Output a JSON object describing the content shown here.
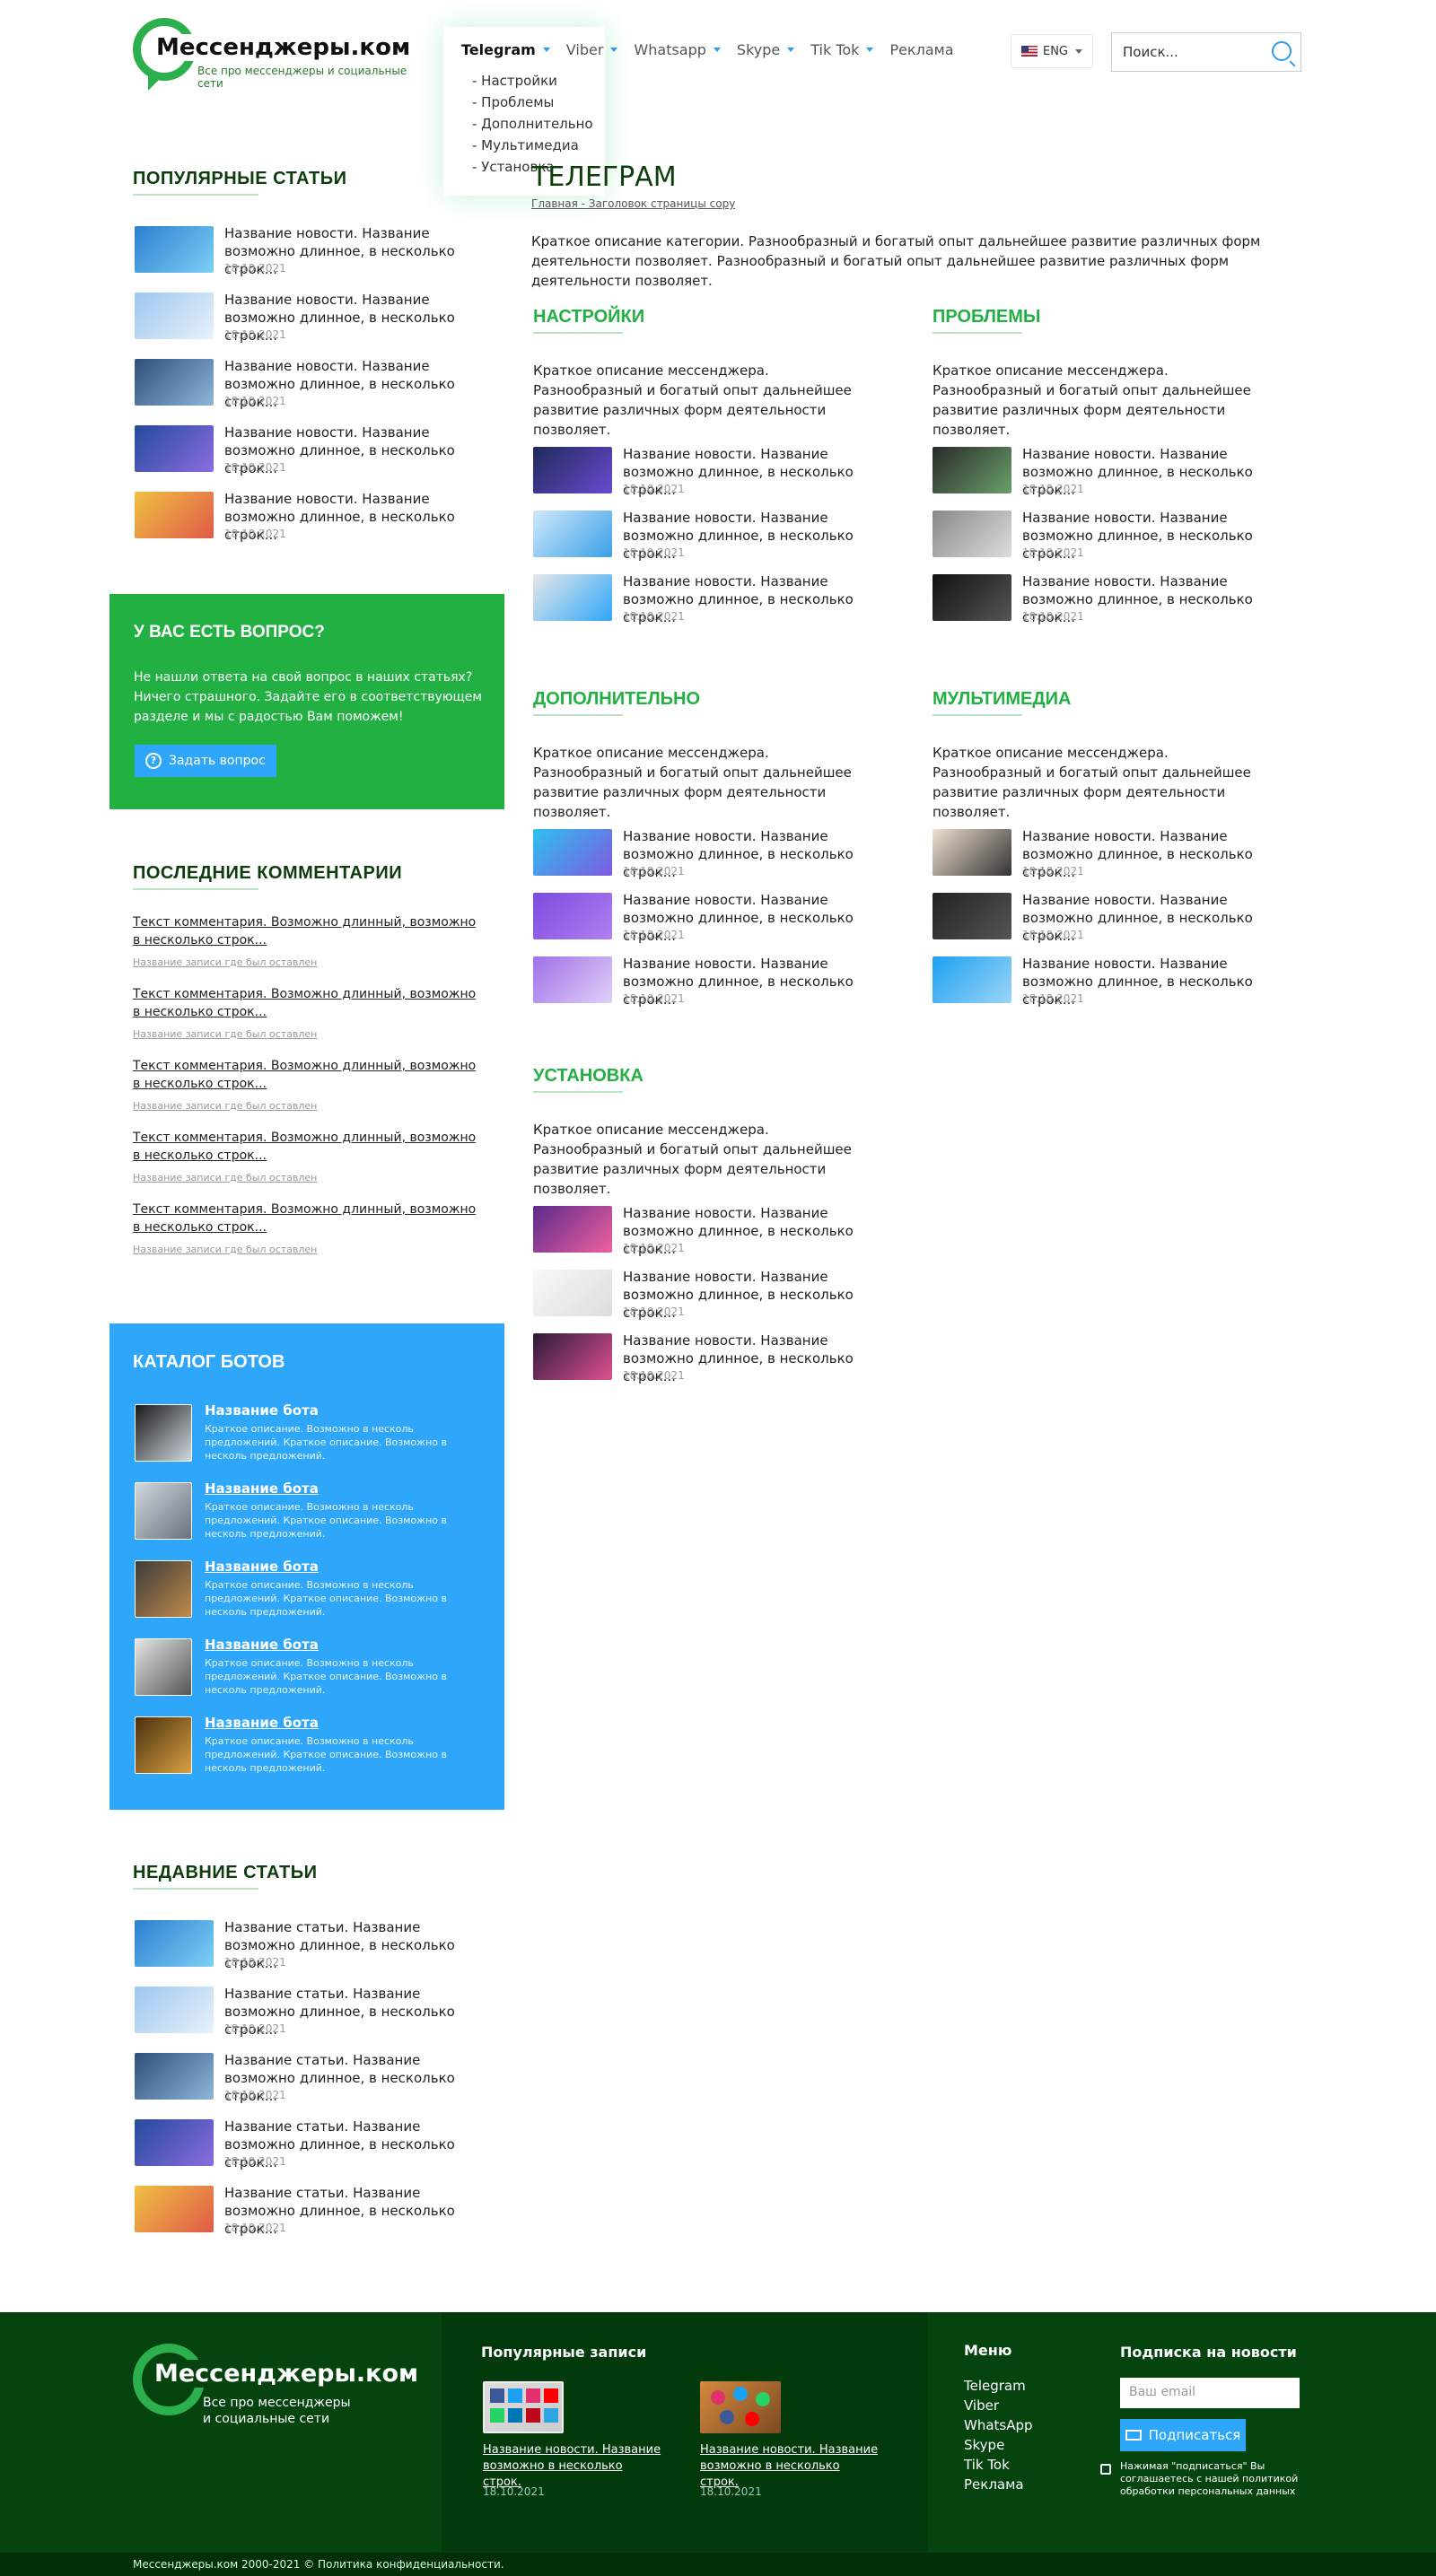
{
  "header": {
    "logo_title": "Мессенджеры.ком",
    "logo_sub": "Все про мессенджеры и социальные сети",
    "nav": [
      "Telegram",
      "Viber",
      "Whatsapp",
      "Skype",
      "Tik Tok",
      "Реклама"
    ],
    "dropdown": [
      "- Настройки",
      "- Проблемы",
      "- Дополнительно",
      "- Мультимедиа",
      "- Установка"
    ],
    "lang": "ENG",
    "search_placeholder": "Поиск..."
  },
  "sidebar": {
    "popular_title": "ПОПУЛЯРНЫЕ СТАТЬИ",
    "popular": [
      {
        "title": "Название новости. Название возможно длинное, в несколько строк...",
        "date": "18.10.2021"
      },
      {
        "title": "Название новости. Название возможно длинное, в несколько строк...",
        "date": "18.10.2021"
      },
      {
        "title": "Название новости. Название возможно длинное, в несколько строк...",
        "date": "18.10.2021"
      },
      {
        "title": "Название новости. Название возможно длинное, в несколько строк...",
        "date": "18.10.2021"
      },
      {
        "title": "Название новости. Название возможно длинное, в несколько строк...",
        "date": "18.10.2021"
      }
    ],
    "question_title": "У ВАС ЕСТЬ ВОПРОС?",
    "question_text": "Не нашли ответа на свой вопрос в наших статьях? Ничего страшного. Задайте его в соответствующем разделе и мы с радостью Вам поможем!",
    "ask_button": "Задать вопрос",
    "comments_title": "ПОСЛЕДНИЕ КОММЕНТАРИИ",
    "comments": [
      {
        "text": "Текст комментария. Возможно длинный, возможно в несколько строк...",
        "src": "Название записи где был оставлен"
      },
      {
        "text": "Текст комментария. Возможно длинный, возможно в несколько строк...",
        "src": "Название записи где был оставлен"
      },
      {
        "text": "Текст комментария. Возможно длинный, возможно в несколько строк...",
        "src": "Название записи где был оставлен"
      },
      {
        "text": "Текст комментария. Возможно длинный, возможно в несколько строк...",
        "src": "Название записи где был оставлен"
      },
      {
        "text": "Текст комментария. Возможно длинный, возможно в несколько строк...",
        "src": "Название записи где был оставлен"
      }
    ],
    "bots_title": "КАТАЛОГ БОТОВ",
    "bots": [
      {
        "name": "Название бота",
        "desc": "Краткое описание. Возможно в несколь предложений. Краткое описание. Возможно в несколь предложений."
      },
      {
        "name": "Название бота",
        "desc": "Краткое описание. Возможно в несколь предложений. Краткое описание. Возможно в несколь предложений."
      },
      {
        "name": "Название бота",
        "desc": "Краткое описание. Возможно в несколь предложений. Краткое описание. Возможно в несколь предложений."
      },
      {
        "name": "Название бота",
        "desc": "Краткое описание. Возможно в несколь предложений. Краткое описание. Возможно в несколь предложений."
      },
      {
        "name": "Название бота",
        "desc": "Краткое описание. Возможно в несколь предложений. Краткое описание. Возможно в несколь предложений."
      }
    ],
    "recent_title": "НЕДАВНИЕ СТАТЬИ",
    "recent": [
      {
        "title": "Название статьи. Название возможно длинное, в несколько строк...",
        "date": "18.10.2021"
      },
      {
        "title": "Название статьи. Название возможно длинное, в несколько строк...",
        "date": "18.10.2021"
      },
      {
        "title": "Название статьи. Название возможно длинное, в несколько строк...",
        "date": "18.10.2021"
      },
      {
        "title": "Название статьи. Название возможно длинное, в несколько строк...",
        "date": "18.10.2021"
      },
      {
        "title": "Название статьи. Название возможно длинное, в несколько строк...",
        "date": "18.10.2021"
      }
    ]
  },
  "main": {
    "title": "ТЕЛЕГРАМ",
    "breadcrumb": "Главная - Заголовок страницы сору",
    "description": "Краткое описание категории. Разнообразный и богатый опыт дальнейшее развитие различных форм деятельности позволяет. Разнообразный и богатый опыт дальнейшее развитие различных форм деятельности позволяет.",
    "sections": [
      {
        "title": "НАСТРОЙКИ",
        "desc": "Краткое описание мессенджера. Разнообразный и богатый опыт дальнейшее развитие различных форм деятельности позволяет.",
        "items": [
          {
            "title": "Название новости. Название возможно длинное, в несколько строк...",
            "date": "18.10.2021"
          },
          {
            "title": "Название новости. Название возможно длинное, в несколько строк...",
            "date": "18.10.2021"
          },
          {
            "title": "Название новости. Название возможно длинное, в несколько строк...",
            "date": "18.10.2021"
          }
        ]
      },
      {
        "title": "ПРОБЛЕМЫ",
        "desc": "Краткое описание мессенджера. Разнообразный и богатый опыт дальнейшее развитие различных форм деятельности позволяет.",
        "items": [
          {
            "title": "Название новости. Название возможно длинное, в несколько строк...",
            "date": "18.10.2021"
          },
          {
            "title": "Название новости. Название возможно длинное, в несколько строк...",
            "date": "18.10.2021"
          },
          {
            "title": "Название новости. Название возможно длинное, в несколько строк...",
            "date": "18.10.2021"
          }
        ]
      },
      {
        "title": "ДОПОЛНИТЕЛЬНО",
        "desc": "Краткое описание мессенджера. Разнообразный и богатый опыт дальнейшее развитие различных форм деятельности позволяет.",
        "items": [
          {
            "title": "Название новости. Название возможно длинное, в несколько строк...",
            "date": "18.10.2021"
          },
          {
            "title": "Название новости. Название возможно длинное, в несколько строк...",
            "date": "18.10.2021"
          },
          {
            "title": "Название новости. Название возможно длинное, в несколько строк...",
            "date": "18.10.2021"
          }
        ]
      },
      {
        "title": "МУЛЬТИМЕДИА",
        "desc": "Краткое описание мессенджера. Разнообразный и богатый опыт дальнейшее развитие различных форм деятельности позволяет.",
        "items": [
          {
            "title": "Название новости. Название возможно длинное, в несколько строк...",
            "date": "18.10.2021"
          },
          {
            "title": "Название новости. Название возможно длинное, в несколько строк...",
            "date": "18.10.2021"
          },
          {
            "title": "Название новости. Название возможно длинное, в несколько строк...",
            "date": "18.10.2021"
          }
        ]
      },
      {
        "title": "УСТАНОВКА",
        "desc": "Краткое описание мессенджера. Разнообразный и богатый опыт дальнейшее развитие различных форм деятельности позволяет.",
        "items": [
          {
            "title": "Название новости. Название возможно длинное, в несколько строк...",
            "date": "18.10.2021"
          },
          {
            "title": "Название новости. Название возможно длинное, в несколько строк...",
            "date": "18.10.2021"
          },
          {
            "title": "Название новости. Название возможно длинное, в несколько строк...",
            "date": "18.10.2021"
          }
        ]
      }
    ]
  },
  "footer": {
    "logo_title": "Мессенджеры.ком",
    "logo_sub1": "Все про мессенджеры",
    "logo_sub2": "и социальные сети",
    "popular_title": "Популярные записи",
    "popular": [
      {
        "title": "Название новости. Название возможно в несколько строк.",
        "date": "18.10.2021"
      },
      {
        "title": "Название новости. Название возможно в несколько строк.",
        "date": "18.10.2021"
      }
    ],
    "menu_title": "Меню",
    "menu": [
      "Telegram",
      "Viber",
      "WhatsApp",
      "Skype",
      "Tik Tok",
      "Реклама"
    ],
    "subscribe_title": "Подписка на новости",
    "email_placeholder": "Ваш email",
    "subscribe_button": "Подписаться",
    "policy": "Нажимая \"подписаться\" Вы соглашаетесь с нашей политикой обработки персональных данных",
    "copyright": "Мессенджеры.ком 2000-2021 © Политика конфиденциальности."
  }
}
